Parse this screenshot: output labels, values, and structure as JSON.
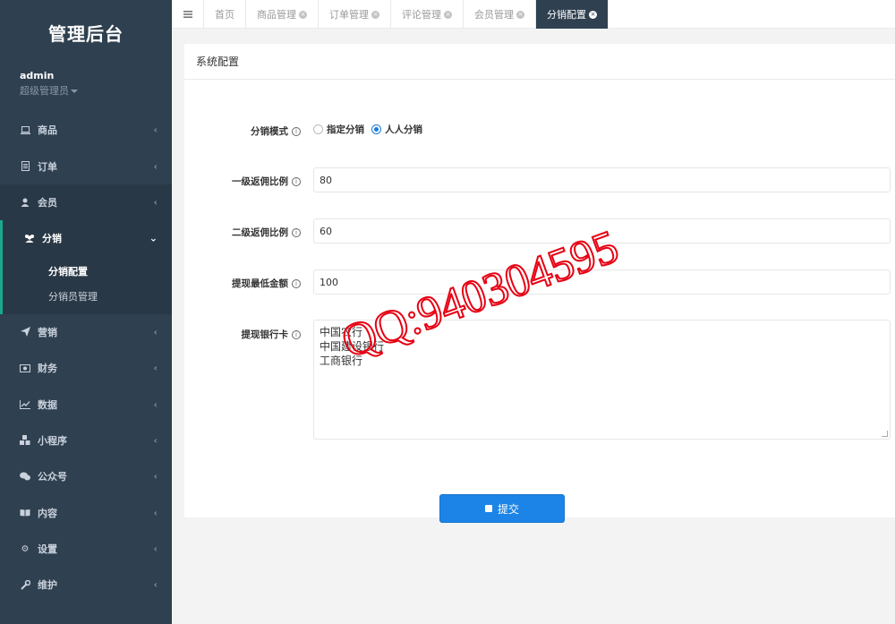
{
  "sidebar": {
    "brand": "管理后台",
    "user": {
      "name": "admin",
      "role": "超级管理员"
    },
    "items": [
      {
        "label": "商品",
        "icon": "laptop-icon"
      },
      {
        "label": "订单",
        "icon": "list-icon"
      },
      {
        "label": "会员",
        "icon": "user-icon"
      },
      {
        "label": "分销",
        "icon": "users-icon"
      },
      {
        "label": "营销",
        "icon": "send-icon"
      },
      {
        "label": "财务",
        "icon": "money-icon"
      },
      {
        "label": "数据",
        "icon": "chart-icon"
      },
      {
        "label": "小程序",
        "icon": "cubes-icon"
      },
      {
        "label": "公众号",
        "icon": "wechat-icon"
      },
      {
        "label": "内容",
        "icon": "book-icon"
      },
      {
        "label": "设置",
        "icon": "gear-icon"
      },
      {
        "label": "维护",
        "icon": "wrench-icon"
      }
    ],
    "submenu": [
      {
        "label": "分销配置"
      },
      {
        "label": "分销员管理"
      }
    ]
  },
  "tabs": [
    {
      "label": "首页"
    },
    {
      "label": "商品管理"
    },
    {
      "label": "订单管理"
    },
    {
      "label": "评论管理"
    },
    {
      "label": "会员管理"
    },
    {
      "label": "分销配置"
    }
  ],
  "panel": {
    "title": "系统配置"
  },
  "form": {
    "mode_label": "分销模式",
    "mode_options": [
      "指定分销",
      "人人分销"
    ],
    "mode_selected": "人人分销",
    "level1_label": "一级返佣比例",
    "level1_value": "80",
    "level2_label": "二级返佣比例",
    "level2_value": "60",
    "min_withdraw_label": "提现最低金额",
    "min_withdraw_value": "100",
    "bank_label": "提现银行卡",
    "bank_lines": [
      "中国农行",
      "中国建设银行",
      "工商银行"
    ],
    "submit_label": "提交"
  },
  "watermark": "QQ:940304595",
  "colors": {
    "sidebar": "#2f4050",
    "accent": "#1c84e6",
    "active_border": "#19aa8d",
    "watermark": "#e60012"
  }
}
